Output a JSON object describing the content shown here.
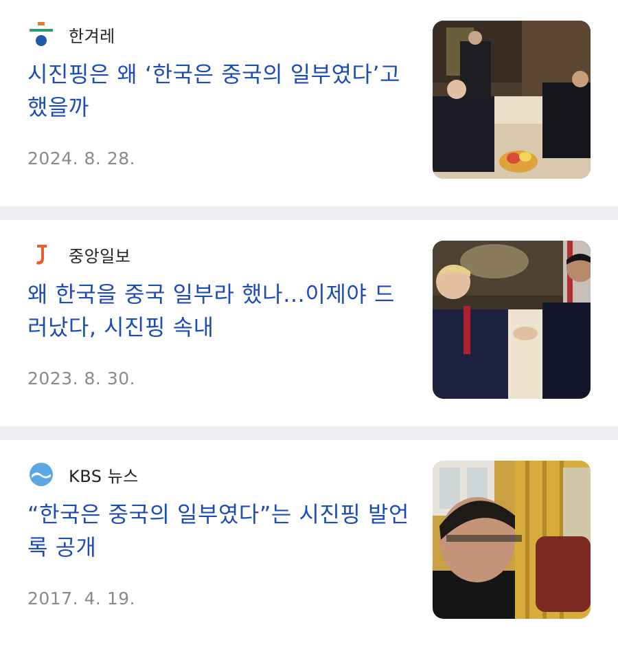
{
  "articles": [
    {
      "source": "한겨레",
      "source_logo": "hankyoreh-logo-icon",
      "headline": "시진핑은 왜 ‘한국은 중국의 일부였다’고 했을까",
      "date": "2024. 8. 28.",
      "thumbnail": "meeting-room-photo"
    },
    {
      "source": "중앙일보",
      "source_logo": "joongang-j-logo-icon",
      "headline": "왜 한국을 중국 일부라 했나…이제야 드러났다, 시진핑 속내",
      "date": "2023. 8. 30.",
      "thumbnail": "handshake-photo"
    },
    {
      "source": "KBS 뉴스",
      "source_logo": "kbs-logo-icon",
      "headline": "“한국은 중국의 일부였다”는 시진핑 발언록 공개",
      "date": "2017. 4. 19.",
      "thumbnail": "oval-office-photo"
    }
  ],
  "colors": {
    "headline": "#1c4cb8",
    "date": "#8a8a8a",
    "divider": "#eceef2",
    "hankyoreh_orange": "#e8762b",
    "hankyoreh_green": "#2f9b6a",
    "hankyoreh_blue": "#1f5aa8",
    "joongang_orange": "#f05a28",
    "kbs_blue": "#5aa7e6"
  }
}
